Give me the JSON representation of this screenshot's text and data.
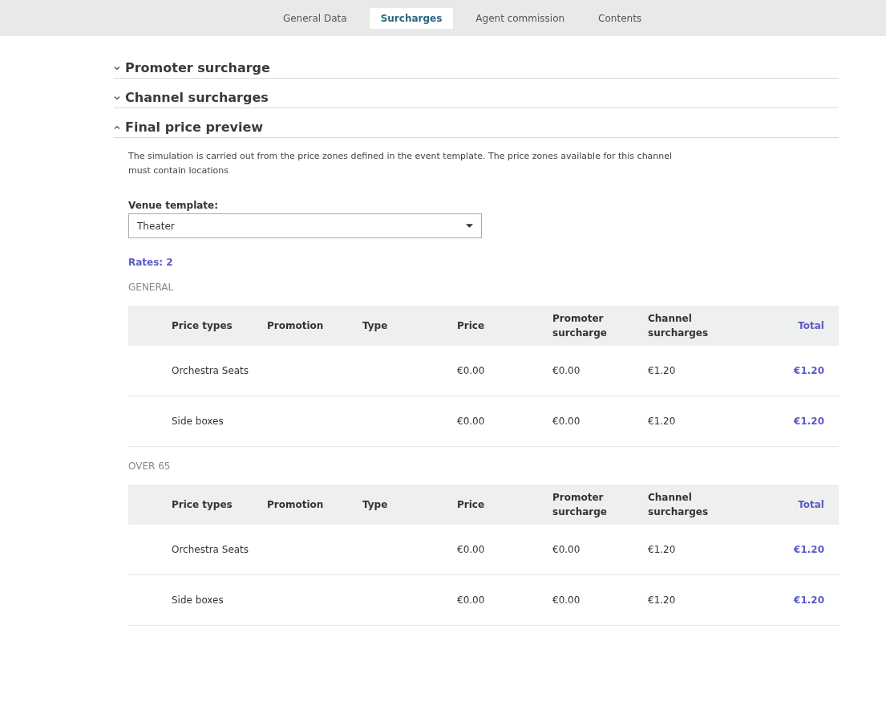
{
  "tabs": [
    {
      "label": "General Data",
      "selected": false
    },
    {
      "label": "Surcharges",
      "selected": true
    },
    {
      "label": "Agent commission",
      "selected": false
    },
    {
      "label": "Contents",
      "selected": false
    }
  ],
  "sections": [
    {
      "title": "Promoter surcharge",
      "expanded": false
    },
    {
      "title": "Channel surcharges",
      "expanded": false
    },
    {
      "title": "Final price preview",
      "expanded": true
    }
  ],
  "preview": {
    "description": "The simulation is carried out from the price zones defined in the event template. The price zones available for this channel must contain locations",
    "venue_label": "Venue template:",
    "venue_value": "Theater",
    "rates": "Rates: 2",
    "groups": [
      {
        "name": "GENERAL",
        "columns": [
          "Price types",
          "Promotion",
          "Type",
          "Price",
          "Promoter surcharge",
          "Channel surcharges",
          "Total"
        ],
        "rows": [
          {
            "price_type": "Orchestra Seats",
            "price": "€0.00",
            "promoter_surcharge": "€0.00",
            "channel_surcharges": "€1.20",
            "total": "€1.20"
          },
          {
            "price_type": "Side boxes",
            "price": "€0.00",
            "promoter_surcharge": "€0.00",
            "channel_surcharges": "€1.20",
            "total": "€1.20"
          }
        ]
      },
      {
        "name": "OVER 65",
        "columns": [
          "Price types",
          "Promotion",
          "Type",
          "Price",
          "Promoter surcharge",
          "Channel surcharges",
          "Total"
        ],
        "rows": [
          {
            "price_type": "Orchestra Seats",
            "price": "€0.00",
            "promoter_surcharge": "€0.00",
            "channel_surcharges": "€1.20",
            "total": "€1.20"
          },
          {
            "price_type": "Side boxes",
            "price": "€0.00",
            "promoter_surcharge": "€0.00",
            "channel_surcharges": "€1.20",
            "total": "€1.20"
          }
        ]
      }
    ]
  }
}
